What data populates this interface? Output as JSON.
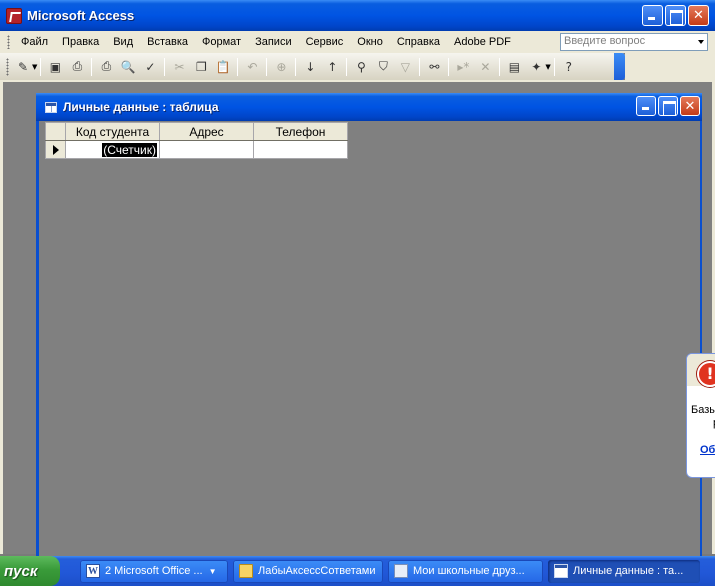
{
  "app": {
    "title": "Microsoft Access"
  },
  "menubar": {
    "items": [
      "Файл",
      "Правка",
      "Вид",
      "Вставка",
      "Формат",
      "Записи",
      "Сервис",
      "Окно",
      "Справка",
      "Adobe PDF"
    ],
    "help_placeholder": "Введите вопрос"
  },
  "toolbar": {
    "icons": [
      "design-view-icon",
      "save-icon",
      "print-preview-setup-icon",
      "print-icon",
      "print-preview-icon",
      "spelling-icon",
      "cut-icon",
      "copy-icon",
      "paste-icon",
      "undo-icon",
      "insert-hyperlink-icon",
      "sort-ascending-icon",
      "sort-descending-icon",
      "filter-by-selection-icon",
      "filter-by-form-icon",
      "apply-filter-icon",
      "find-icon",
      "new-record-icon",
      "delete-record-icon",
      "database-window-icon",
      "new-object-icon",
      "help-icon"
    ]
  },
  "table_window": {
    "title": "Личные данные : таблица",
    "columns": [
      "Код студента",
      "Адрес",
      "Телефон"
    ],
    "new_row": {
      "values": [
        "(Счетчик)",
        "",
        ""
      ]
    }
  },
  "popup": {
    "line1": "Базы",
    "line2": "р",
    "link": "Об"
  },
  "taskbar": {
    "start_label": "пуск",
    "tasks": [
      {
        "label": "2 Microsoft Office ...",
        "icon": "word-icon"
      },
      {
        "label": "ЛабыАксессСответами",
        "icon": "folder-icon"
      },
      {
        "label": "Мои школьные друз...",
        "icon": "document-icon"
      },
      {
        "label": "Личные данные : та...",
        "icon": "table-icon"
      }
    ]
  }
}
